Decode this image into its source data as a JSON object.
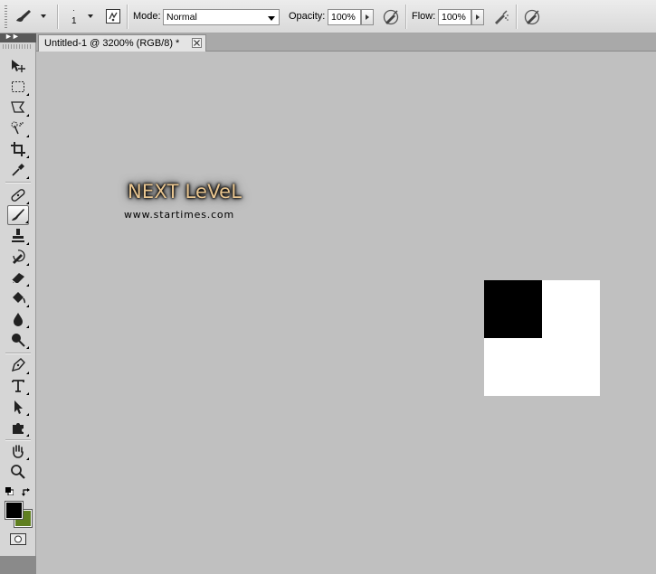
{
  "options_bar": {
    "brush_size": "1",
    "mode_label": "Mode:",
    "mode_value": "Normal",
    "opacity_label": "Opacity:",
    "opacity_value": "100%",
    "flow_label": "Flow:",
    "flow_value": "100%"
  },
  "document": {
    "tab_title": "Untitled-1 @ 3200% (RGB/8) *"
  },
  "watermark": {
    "title": "NEXT LeVeL",
    "url": "www.startimes.com"
  },
  "tools": [
    "move-tool",
    "rectangular-marquee-tool",
    "lasso-tool",
    "quick-selection-tool",
    "crop-tool",
    "eyedropper-tool",
    "spot-healing-brush-tool",
    "brush-tool",
    "clone-stamp-tool",
    "history-brush-tool",
    "eraser-tool",
    "paint-bucket-tool",
    "blur-tool",
    "dodge-tool",
    "pen-tool",
    "type-tool",
    "path-selection-tool",
    "custom-shape-tool",
    "hand-tool",
    "zoom-tool"
  ],
  "active_tool": "brush-tool",
  "colors": {
    "foreground": "#000000",
    "background": "#5f7f1f",
    "canvas": "#c0c0c0",
    "pixel_white": "#ffffff",
    "pixel_black": "#000000"
  }
}
